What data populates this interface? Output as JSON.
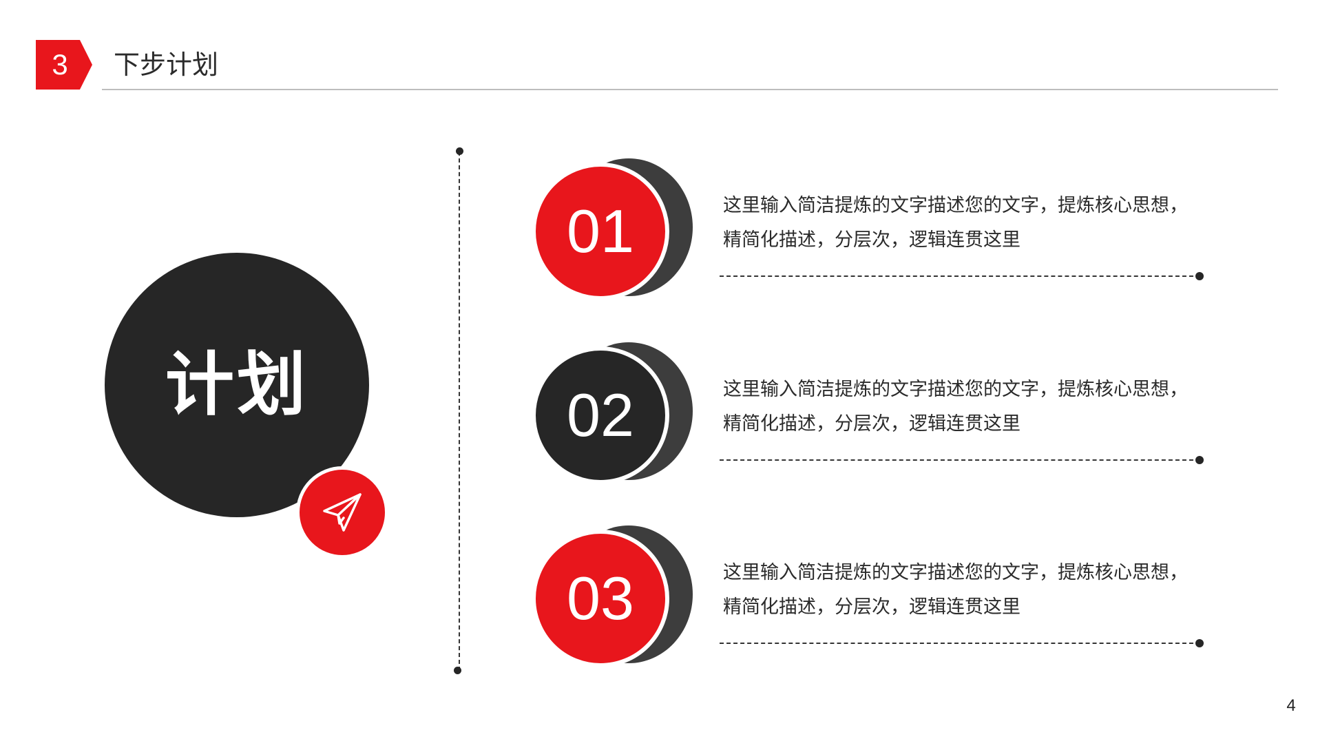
{
  "header": {
    "section_number": "3",
    "section_title": "下步计划"
  },
  "main_circle": {
    "label": "计划"
  },
  "badge": {
    "icon": "paper-plane-icon"
  },
  "items": [
    {
      "number": "01",
      "text": "这里输入简洁提炼的文字描述您的文字，提炼核心思想，精简化描述，分层次，逻辑连贯这里",
      "color": "#e8161c"
    },
    {
      "number": "02",
      "text": "这里输入简洁提炼的文字描述您的文字，提炼核心思想，精简化描述，分层次，逻辑连贯这里",
      "color": "#262626"
    },
    {
      "number": "03",
      "text": "这里输入简洁提炼的文字描述您的文字，提炼核心思想，精简化描述，分层次，逻辑连贯这里",
      "color": "#e8161c"
    }
  ],
  "colors": {
    "accent": "#e8161c",
    "dark": "#262626"
  },
  "footer": {
    "page_number": "4"
  }
}
